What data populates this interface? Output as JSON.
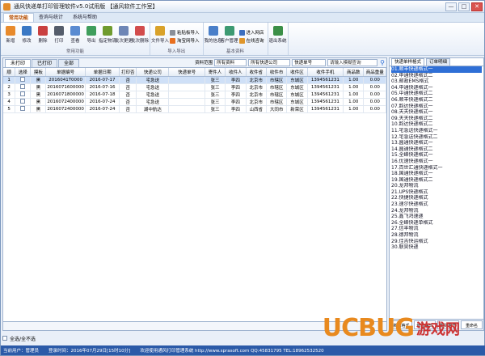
{
  "window": {
    "title": "通风快递单打印管理软件v5.0试用版 【通风软件工作室】",
    "min": "—",
    "max": "□",
    "close": "✕"
  },
  "menu_tabs": [
    "常用功能",
    "查询与统计",
    "系统与帮助"
  ],
  "ribbon": {
    "common": {
      "label": "常用功能",
      "buttons": [
        {
          "label": "新增",
          "icon": "add-doc-icon",
          "color": "#e88a2c"
        },
        {
          "label": "修改",
          "icon": "edit-icon",
          "color": "#3a78c4"
        },
        {
          "label": "删除",
          "icon": "delete-icon",
          "color": "#c94040"
        },
        {
          "label": "打印",
          "icon": "print-icon",
          "color": "#555d6b"
        },
        {
          "label": "查看",
          "icon": "view-icon",
          "color": "#5a8bd1"
        },
        {
          "label": "导出",
          "icon": "export-icon",
          "color": "#3f9e5c"
        },
        {
          "label": "指定物流",
          "icon": "logistics-icon",
          "color": "#6f9b2e"
        },
        {
          "label": "批次更更",
          "icon": "batch-change-icon",
          "color": "#6e86b6"
        },
        {
          "label": "批次删除",
          "icon": "batch-delete-icon",
          "color": "#d24c4c"
        }
      ]
    },
    "import": {
      "label": "导入导出",
      "buttons": [
        {
          "label": "文件导入",
          "icon": "file-import-icon",
          "color": "#d9a22a"
        }
      ],
      "small": [
        {
          "label": "粘贴板导入",
          "icon": "clipboard-icon",
          "color": "#8a8f99"
        },
        {
          "label": "淘宝网导入",
          "icon": "taobao-icon",
          "color": "#e86f1f"
        }
      ]
    },
    "base": {
      "label": "基本资料",
      "buttons": [
        {
          "label": "我的信息",
          "icon": "user-info-icon",
          "color": "#4a7fc9"
        },
        {
          "label": "客户管理",
          "icon": "customers-icon",
          "color": "#3d9a72"
        }
      ],
      "small": [
        {
          "label": "进入网店",
          "icon": "shop-icon",
          "color": "#3c6fbf"
        },
        {
          "label": "在线咨询",
          "icon": "chat-icon",
          "color": "#e0962b"
        }
      ]
    },
    "exit": {
      "label": "退出系统",
      "icon": "exit-icon",
      "color": "#3b8f47"
    }
  },
  "grid_tabs": [
    "未打印",
    "已打印",
    "全部"
  ],
  "filter": {
    "range_label": "资料范围",
    "range_value": "所有资料",
    "company_value": "所有快递公司",
    "field_value": "快递单号",
    "keyword_placeholder": "请输入模糊查询"
  },
  "table": {
    "headers": [
      "顺",
      "选择",
      "摸板",
      "单据编号",
      "单据日期",
      "打印否",
      "快递公司",
      "快递单号",
      "寄件人",
      "收件人",
      "收件省",
      "收件市",
      "收件区",
      "收件手机",
      "商品数",
      "商品重量"
    ],
    "rows": [
      [
        "1",
        "",
        "黑",
        "2016041T0000",
        "2016-07-17",
        "否",
        "宅急送",
        "",
        "张三",
        "李四",
        "北京市",
        "市辖区",
        "东城区",
        "1394561231",
        "1.00",
        "0.00"
      ],
      [
        "2",
        "",
        "黑",
        "2016071600000",
        "2016-07-16",
        "否",
        "宅急送",
        "",
        "张三",
        "李四",
        "北京市",
        "市辖区",
        "东城区",
        "1394561231",
        "1.00",
        "0.00"
      ],
      [
        "3",
        "",
        "黑",
        "2016071800000",
        "2016-07-18",
        "否",
        "宅急送",
        "",
        "张三",
        "李四",
        "北京市",
        "市辖区",
        "东城区",
        "1394561231",
        "1.00",
        "0.00"
      ],
      [
        "4",
        "",
        "黑",
        "2016072400000",
        "2016-07-24",
        "否",
        "宅急送",
        "",
        "张三",
        "李四",
        "北京市",
        "市辖区",
        "东城区",
        "1394561231",
        "1.00",
        "0.00"
      ],
      [
        "5",
        "",
        "黑",
        "2016072400000",
        "2016-07-24",
        "否",
        "湖中航达",
        "",
        "张三",
        "李四",
        "山西省",
        "大同市",
        "新荣区",
        "1394561231",
        "1.00",
        "0.00"
      ]
    ]
  },
  "bottom": {
    "select_all": "全选/全不选"
  },
  "right_panel": {
    "tabs": [
      "快递单样格式",
      "订单明细"
    ],
    "templates": [
      "01.顺丰快递格式一",
      "02.申通快递格式二",
      "03.邮政EMS格式",
      "04.申通快递格式一",
      "05.中通快递格式二",
      "06.顺丰快递格式二",
      "07.韵达快递格式一",
      "08.天天快递格式一",
      "09.天天快递格式二",
      "10.韵达快递格式二",
      "11.宅急送快递格式一",
      "12.宅急送快递格式二",
      "13.圆通快递格式一",
      "14.圆通快递格式二",
      "15.全峰快递格式一",
      "16.优速快递格式一",
      "17.百世汇通快递格式一",
      "18.国通快递格式一",
      "19.国通快递格式二",
      "20.龙邦物流",
      "21.UPS快递格式",
      "22.快捷快递格式",
      "23.速尔快递格式",
      "24.龙邦物流",
      "25.鑫飞鸿速递",
      "26.全峰快递单格式",
      "27.信丰物流",
      "28.德邦物流",
      "29.佳吉快运格式",
      "30.联昊快递"
    ],
    "buttons": [
      "新增格式",
      "修改格式",
      "删除格式",
      "重命名"
    ]
  },
  "status": {
    "user": "当前用户：管理员",
    "login": "登录时间：2016年07月29日[15时10分]",
    "welcome": "欢迎使用通风打印管理系统 http://www.sprasoft.com QQ:45831795 TEL:18962532520"
  },
  "watermark": {
    "text": "UCBUG",
    "cn": "游戏网"
  }
}
